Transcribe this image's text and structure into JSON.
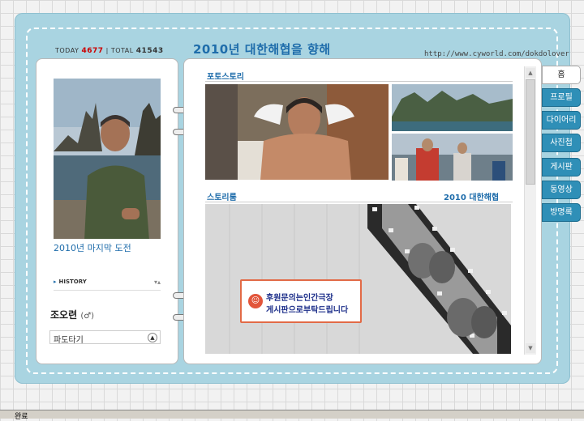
{
  "counter": {
    "today_label": "TODAY",
    "today_value": "4677",
    "sep": "|",
    "total_label": "TOTAL",
    "total_value": "41543"
  },
  "header": {
    "title": "2010년 대한해협을 향해",
    "url": "http://www.cyworld.com/dokdolover"
  },
  "profile": {
    "caption": "2010년 마지막 도전",
    "history_label": "HISTORY",
    "owner_name": "조오련",
    "owner_sex": "(♂)",
    "select_value": "파도타기"
  },
  "main": {
    "photostory_title": "포토스토리",
    "storyroom_title": "스토리룸",
    "storyroom_subtitle": "2010 대한해협",
    "banner_line1": "후원문의는인간극장",
    "banner_line2": "게시판으로부탁드립니다"
  },
  "tabs": [
    {
      "label": "홈",
      "active": true
    },
    {
      "label": "프로필",
      "active": false
    },
    {
      "label": "다이어리",
      "active": false
    },
    {
      "label": "사진첩",
      "active": false
    },
    {
      "label": "게시판",
      "active": false
    },
    {
      "label": "동영상",
      "active": false
    },
    {
      "label": "방명록",
      "active": false
    }
  ],
  "statusbar": {
    "text": "완료"
  },
  "colors": {
    "frame": "#a9d4e1",
    "accent": "#1f6dab",
    "tab": "#2f8fb7",
    "banner_border": "#e26a46"
  }
}
